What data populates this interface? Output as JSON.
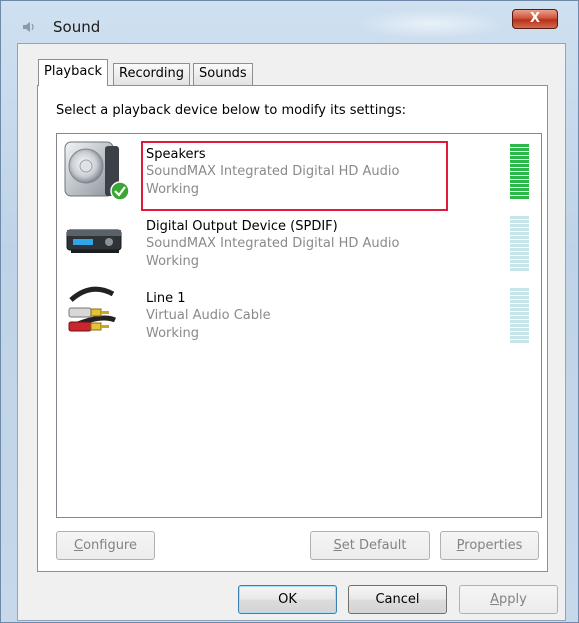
{
  "window": {
    "title": "Sound",
    "close_label": "X"
  },
  "tabs": [
    {
      "label": "Playback",
      "active": true
    },
    {
      "label": "Recording",
      "active": false
    },
    {
      "label": "Sounds",
      "active": false
    }
  ],
  "instruction": "Select a playback device below to modify its settings:",
  "devices": [
    {
      "name": "Speakers",
      "driver": "SoundMAX Integrated Digital HD Audio",
      "status": "Working",
      "icon": "speaker-icon",
      "is_default": true,
      "selected": true,
      "meter_level": 1.0
    },
    {
      "name": "Digital Output Device (SPDIF)",
      "driver": "SoundMAX Integrated Digital HD Audio",
      "status": "Working",
      "icon": "digital-output-icon",
      "is_default": false,
      "selected": false,
      "meter_level": 0
    },
    {
      "name": "Line 1",
      "driver": "Virtual Audio Cable",
      "status": "Working",
      "icon": "audio-cable-icon",
      "is_default": false,
      "selected": false,
      "meter_level": 0
    }
  ],
  "panel_buttons": {
    "configure": {
      "accel": "C",
      "rest": "onfigure"
    },
    "set_default": {
      "accel": "S",
      "rest": "et Default"
    },
    "properties": {
      "accel": "P",
      "rest": "roperties"
    }
  },
  "dialog_buttons": {
    "ok": "OK",
    "cancel": "Cancel",
    "apply": {
      "accel": "A",
      "rest": "pply"
    }
  },
  "colors": {
    "highlight_border": "#e01b3a",
    "meter_active": "#2db84a",
    "meter_idle": "#c6e5ea",
    "default_check": "#3aa635"
  }
}
